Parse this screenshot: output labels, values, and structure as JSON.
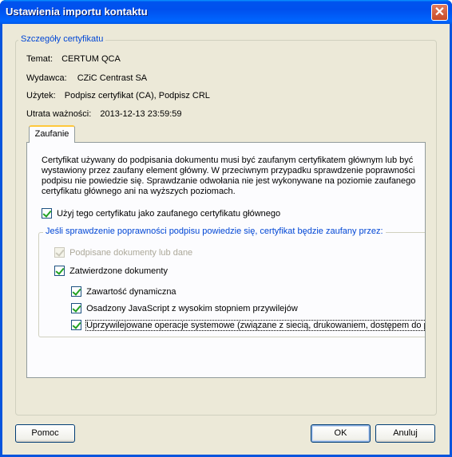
{
  "window": {
    "title": "Ustawienia importu kontaktu"
  },
  "details": {
    "legend": "Szczegóły certyfikatu",
    "subject_label": "Temat:",
    "subject_value": "CERTUM QCA",
    "issuer_label": "Wydawca:",
    "issuer_value": "CZiC Centrast SA",
    "usage_label": "Użytek:",
    "usage_value": "Podpisz certyfikat (CA), Podpisz CRL",
    "expiry_label": "Utrata ważności:",
    "expiry_value": "2013-12-13 23:59:59"
  },
  "tabs": [
    {
      "label": "Zaufanie",
      "active": true
    }
  ],
  "trust": {
    "paragraph": "Certyfikat używany do podpisania dokumentu musi być zaufanym certyfikatem głównym lub być wystawiony przez zaufany element główny. W przeciwnym przypadku sprawdzenie poprawności podpisu nie powiedzie się.  Sprawdzanie odwołania nie jest wykonywane na poziomie zaufanego certyfikatu głównego ani na wyższych poziomach.",
    "use_as_root_label": "Użyj tego certyfikatu jako zaufanego certyfikatu głównego",
    "use_as_root_checked": true,
    "group_legend": "Jeśli sprawdzenie poprawności podpisu powiedzie się, certyfikat będzie zaufany przez:",
    "options": [
      {
        "label": "Podpisane dokumenty lub dane",
        "checked": true,
        "enabled": false
      },
      {
        "label": "Zatwierdzone dokumenty",
        "checked": true,
        "enabled": true
      },
      {
        "label": "Zawartość dynamiczna",
        "checked": true,
        "enabled": true
      },
      {
        "label": "Osadzony JavaScript z wysokim stopniem przywilejów",
        "checked": true,
        "enabled": true
      },
      {
        "label": "Uprzywilejowane operacje systemowe (związane z siecią, drukowaniem, dostępem do plików",
        "checked": true,
        "enabled": true
      }
    ]
  },
  "buttons": {
    "help": "Pomoc",
    "ok": "OK",
    "cancel": "Anuluj"
  },
  "colors": {
    "titlebar": "#0054e3",
    "face": "#ece9d8",
    "legend": "#0046d5",
    "close": "#c74b27"
  },
  "icons": {
    "close": "close-icon",
    "checkmark": "checkmark-icon"
  }
}
